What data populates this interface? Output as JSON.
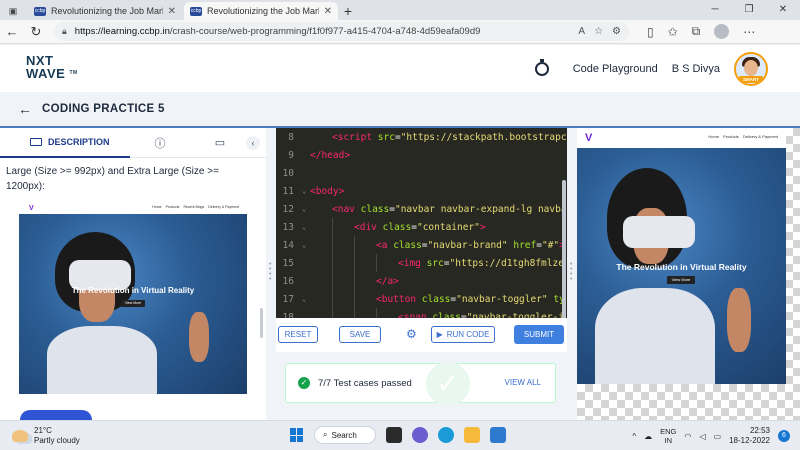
{
  "browser": {
    "tabs": [
      {
        "title": "Revolutionizing the Job Market |",
        "active": false
      },
      {
        "title": "Revolutionizing the Job Market |",
        "active": true
      }
    ],
    "new_tab": "+",
    "url_host": "https://learning.ccbp.in",
    "url_path": "/crash-course/web-programming/f1f0f977-a415-4704-a748-4d59eafa09d9"
  },
  "site": {
    "logo_top": "NXT",
    "logo_bottom": "WAVE",
    "logo_tm": "TM",
    "code_playground": "Code Playground",
    "user_name": "B S Divya",
    "avatar_badge": "SMART"
  },
  "practice": {
    "title": "CODING PRACTICE 5"
  },
  "description": {
    "tab_label": "DESCRIPTION",
    "text": "Large (Size >= 992px) and Extra Large (Size >= 1200px):"
  },
  "mock_site": {
    "nav_links": [
      "Home",
      "Products",
      "Recent Blogs",
      "Delivery & Payment"
    ],
    "output_nav_links": [
      "Home",
      "Products",
      "Delivery & Payment"
    ],
    "heading": "The Revolution in Virtual Reality",
    "button": "View More"
  },
  "editor": {
    "lines": [
      {
        "n": "8",
        "indent": 1,
        "html": "<span class='tag'>&lt;script</span> <span class='attr'>src</span>=<span class='str'>\"https://stackpath.bootstrapc</span>"
      },
      {
        "n": "9",
        "indent": 0,
        "html": "<span class='tag'>&lt;/head&gt;</span>"
      },
      {
        "n": "10",
        "indent": 0,
        "html": ""
      },
      {
        "n": "11",
        "indent": 0,
        "fold": true,
        "html": "<span class='tag'>&lt;body&gt;</span>"
      },
      {
        "n": "12",
        "indent": 1,
        "fold": true,
        "html": "<span class='tag'>&lt;nav</span> <span class='attr'>class</span>=<span class='str'>\"navbar navbar-expand-lg navba</span>"
      },
      {
        "n": "13",
        "indent": 2,
        "fold": true,
        "html": "<span class='tag'>&lt;div</span> <span class='attr'>class</span>=<span class='str'>\"container\"</span><span class='tag'>&gt;</span>"
      },
      {
        "n": "14",
        "indent": 3,
        "fold": true,
        "html": "<span class='tag'>&lt;a</span> <span class='attr'>class</span>=<span class='str'>\"navbar-brand\"</span> <span class='attr'>href</span>=<span class='str'>\"#\"</span><span class='tag'>&gt;</span>"
      },
      {
        "n": "15",
        "indent": 4,
        "html": "<span class='tag'>&lt;img</span> <span class='attr'>src</span>=<span class='str'>\"https://d1tgh8fmlze</span>"
      },
      {
        "n": "16",
        "indent": 3,
        "html": "<span class='tag'>&lt;/a&gt;</span>"
      },
      {
        "n": "17",
        "indent": 3,
        "fold": true,
        "html": "<span class='tag'>&lt;button</span> <span class='attr'>class</span>=<span class='str'>\"navbar-toggler\"</span> <span class='attr'>ty</span>"
      },
      {
        "n": "18",
        "indent": 4,
        "html": "<span class='tag'>&lt;span</span> <span class='attr'>class</span>=<span class='str'>\"navbar-toggler-i</span>"
      }
    ]
  },
  "actions": {
    "reset": "RESET",
    "save": "SAVE",
    "run_code": "RUN CODE",
    "submit": "SUBMIT"
  },
  "results": {
    "text": "7/7 Test cases passed",
    "view_all": "VIEW ALL"
  },
  "taskbar": {
    "temp": "21°C",
    "weather": "Partly cloudy",
    "search": "Search",
    "lang_top": "ENG",
    "lang_bottom": "IN",
    "time": "22:53",
    "date": "18-12-2022",
    "notifications": "6"
  },
  "colors": {
    "accent": "#3b6fd0",
    "title_dark": "#183b56",
    "editor_bg": "#272822",
    "success": "#16a34a"
  }
}
